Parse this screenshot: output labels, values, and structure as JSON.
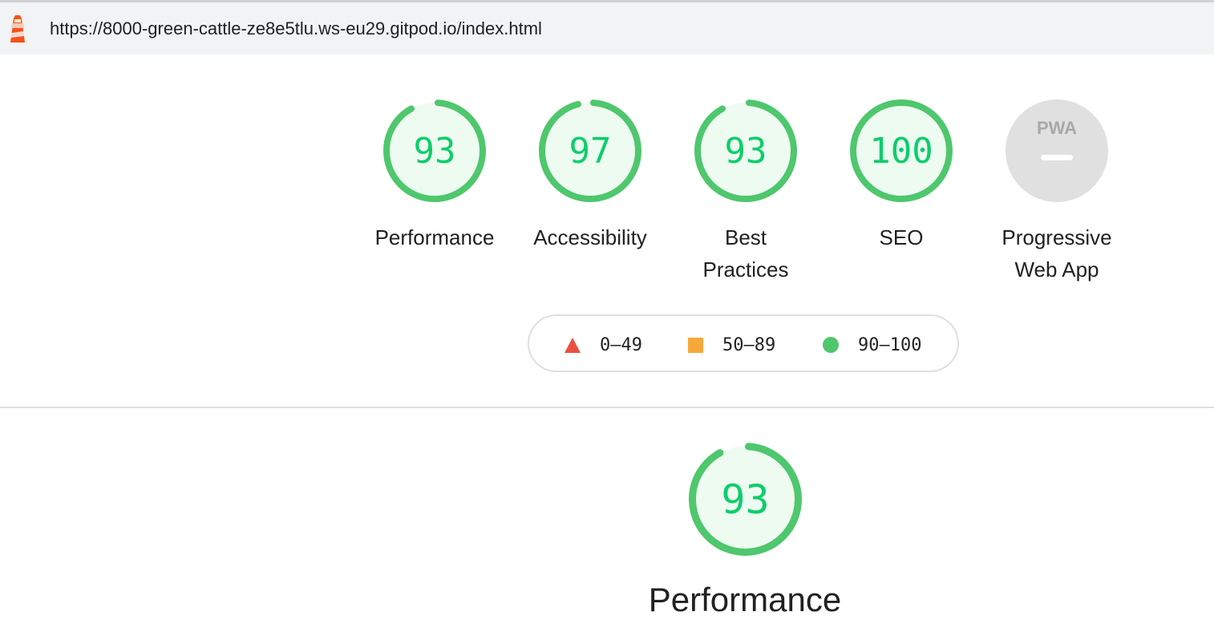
{
  "browser": {
    "url": "https://8000-green-cattle-ze8e5tlu.ws-eu29.gitpod.io/index.html",
    "logo_icon": "lighthouse-icon"
  },
  "colors": {
    "pass": "#0cce6b",
    "pass_ring": "#4ec76d",
    "pass_fill": "#eefbf1",
    "average": "#f6a93a",
    "fail": "#eb4f3f",
    "na_fill": "#e0e0e0"
  },
  "gauges": [
    {
      "score": "93",
      "value": 0.93,
      "label": "Performance"
    },
    {
      "score": "97",
      "value": 0.97,
      "label": "Accessibility"
    },
    {
      "score": "93",
      "value": 0.93,
      "label": "Best Practices"
    },
    {
      "score": "100",
      "value": 1.0,
      "label": "SEO"
    },
    {
      "score": "",
      "value": null,
      "label": "Progressive Web App",
      "badge": "PWA",
      "icon": "pwa-icon"
    }
  ],
  "legend": [
    {
      "range": "0–49",
      "icon": "triangle-fail-icon"
    },
    {
      "range": "50–89",
      "icon": "square-average-icon"
    },
    {
      "range": "90–100",
      "icon": "circle-pass-icon"
    }
  ],
  "performance_section": {
    "score": "93",
    "value": 0.93,
    "title": "Performance"
  }
}
